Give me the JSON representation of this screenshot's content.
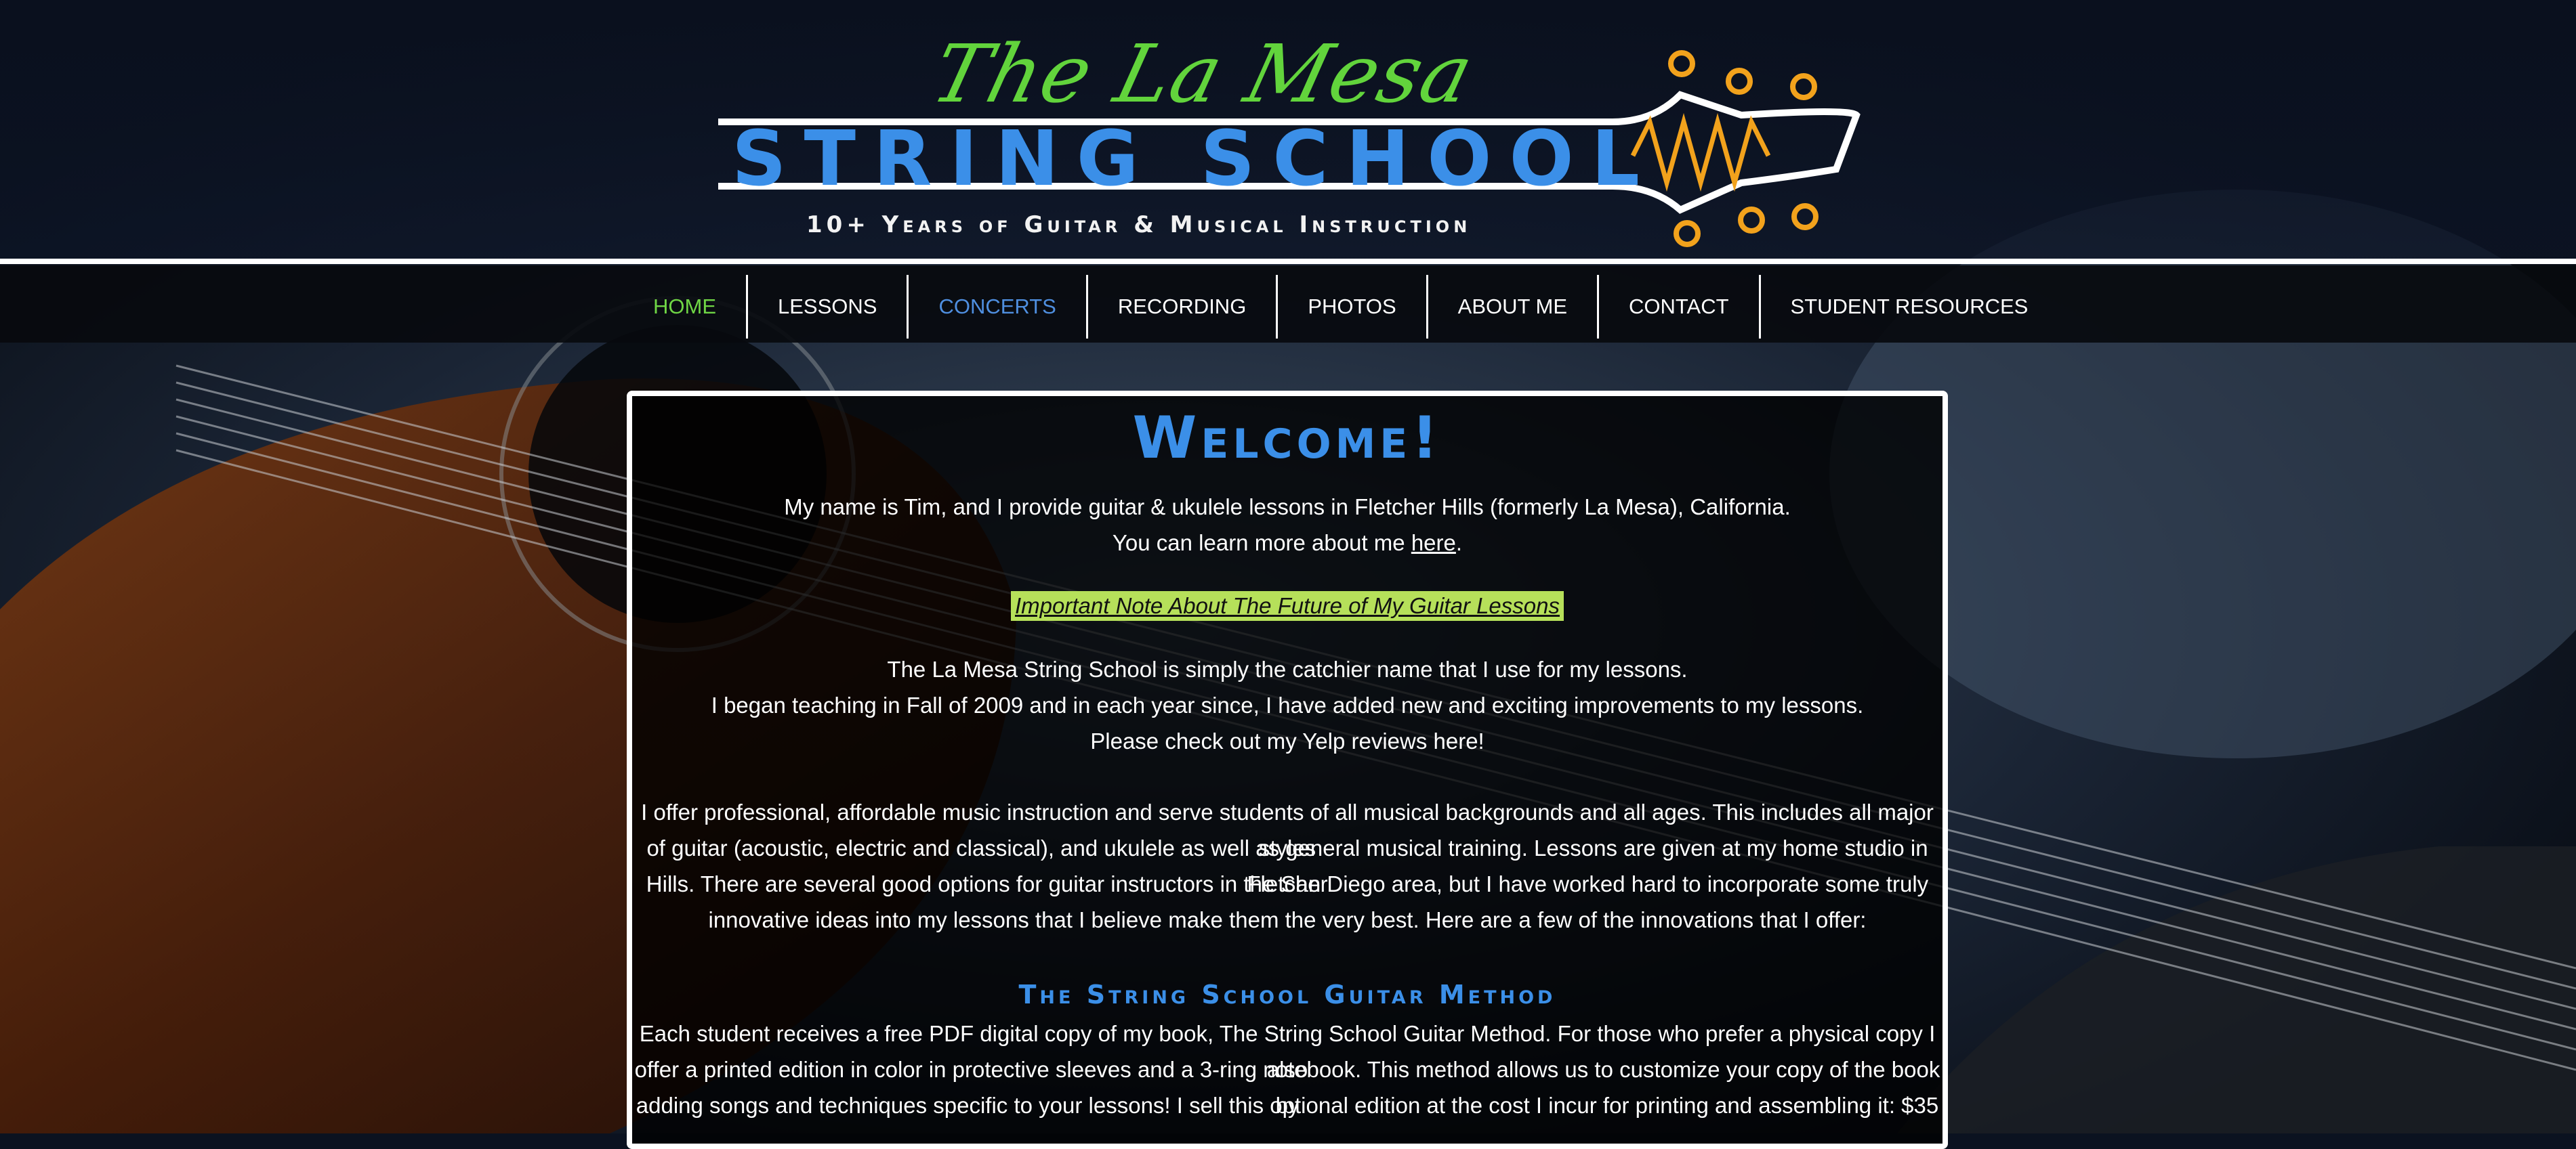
{
  "logo": {
    "script_text": "The La Mesa",
    "main_text": "STRING SCHOOL",
    "tagline": "10+ Years of Guitar & Musical Instruction",
    "colors": {
      "script": "#62d43c",
      "main": "#3b8fe8",
      "accent": "#f2a21c"
    }
  },
  "nav": {
    "items": [
      {
        "label": "HOME",
        "state": "active"
      },
      {
        "label": "LESSONS",
        "state": "normal"
      },
      {
        "label": "CONCERTS",
        "state": "hover"
      },
      {
        "label": "RECORDING",
        "state": "normal"
      },
      {
        "label": "PHOTOS",
        "state": "normal"
      },
      {
        "label": "ABOUT ME",
        "state": "normal"
      },
      {
        "label": "CONTACT",
        "state": "normal"
      },
      {
        "label": "STUDENT RESOURCES",
        "state": "normal"
      }
    ],
    "colors": {
      "active": "#6fd545",
      "hover": "#4f8fe0",
      "normal": "#ffffff"
    }
  },
  "content": {
    "title": "Welcome!",
    "intro_line1": "My name is Tim, and I provide guitar & ukulele lessons in Fletcher Hills (formerly La Mesa), California.",
    "intro_line2_prefix": "You can learn more about me ",
    "intro_line2_link": "here",
    "intro_line2_suffix": ".",
    "important_note": "Important Note About The Future of My Guitar Lessons",
    "about_line1": "The La Mesa String School is simply the catchier name that I use for my lessons.",
    "about_line2": "I began teaching in Fall of 2009 and in each year since, I have added new and exciting improvements to my lessons.",
    "about_line3": "Please check out my Yelp reviews here!",
    "offer_line1": "I offer professional, affordable music instruction and serve students of all musical backgrounds and all ages. This includes all major styles",
    "offer_line2": "of guitar (acoustic, electric and classical), and ukulele as well as general musical training. Lessons are given at my home studio in Fletcher",
    "offer_line3": "Hills. There are several good options for guitar instructors in the San Diego area, but I have worked hard to incorporate some truly",
    "offer_line4": "innovative ideas into my lessons that I believe make them the very best. Here are a few of the innovations that I offer:",
    "method_title": "The String School Guitar Method",
    "method_line1": "Each student receives a free PDF digital copy of my book, The String School Guitar Method. For those who prefer a physical copy I also",
    "method_line2": "offer a printed edition in color in protective sleeves and a 3-ring notebook. This method allows us to customize your copy of the book by",
    "method_line3": "adding songs and techniques specific to your lessons! I sell this optional edition at the cost I incur for printing and assembling it: $35"
  }
}
